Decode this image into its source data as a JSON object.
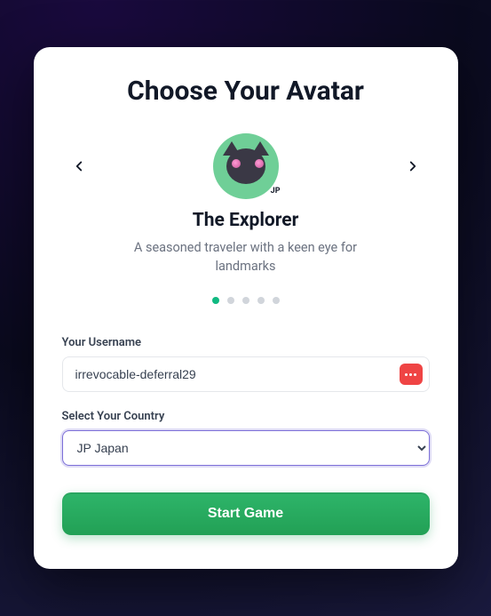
{
  "title": "Choose Your Avatar",
  "avatar": {
    "name": "The Explorer",
    "description": "A seasoned traveler with a keen eye for landmarks",
    "flag_chip": "JP"
  },
  "pager": {
    "total": 5,
    "active_index": 0
  },
  "username": {
    "label": "Your Username",
    "value": "irrevocable-deferral29"
  },
  "country": {
    "label": "Select Your Country",
    "selected_prefix": "JP",
    "selected_name": "Japan"
  },
  "actions": {
    "start_label": "Start Game"
  }
}
